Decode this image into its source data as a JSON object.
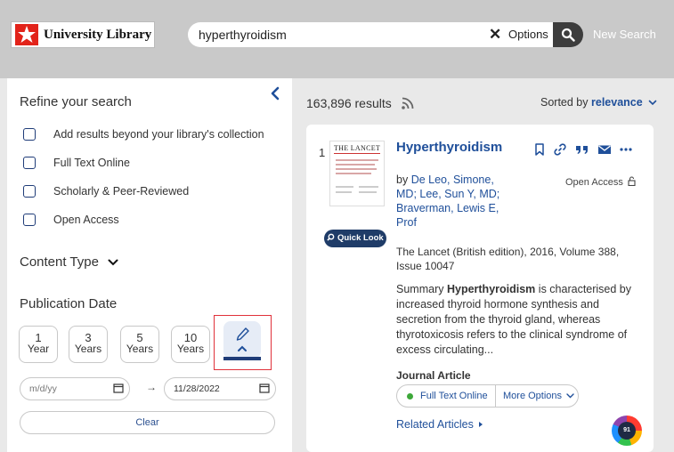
{
  "header": {
    "logo_text": "University Library",
    "search_value": "hyperthyroidism",
    "options_label": "Options",
    "new_search_label": "New Search"
  },
  "refine": {
    "title": "Refine your search",
    "checkboxes": [
      {
        "label": "Add results beyond your library's collection",
        "checked": false
      },
      {
        "label": "Full Text Online",
        "checked": false
      },
      {
        "label": "Scholarly & Peer-Reviewed",
        "checked": false
      },
      {
        "label": "Open Access",
        "checked": false
      }
    ],
    "content_type_label": "Content Type",
    "publication_date_label": "Publication Date",
    "year_buttons": [
      {
        "num": "1",
        "unit": "Year"
      },
      {
        "num": "3",
        "unit": "Years"
      },
      {
        "num": "5",
        "unit": "Years"
      },
      {
        "num": "10",
        "unit": "Years"
      }
    ],
    "date_from_placeholder": "m/d/yy",
    "date_to_value": "11/28/2022",
    "arrow": "→",
    "clear_label": "Clear"
  },
  "results": {
    "count": "163,896 results",
    "sorted_by_prefix": "Sorted by",
    "sorted_by_value": "relevance",
    "record": {
      "number": "1",
      "thumbnail_title": "THE LANCET",
      "quick_look_label": "Quick Look",
      "title": "Hyperthyroidism",
      "by_prefix": "by",
      "authors": "De Leo, Simone, MD; Lee, Sun Y, MD; Braverman, Lewis E, Prof",
      "open_access_label": "Open Access",
      "source": "The Lancet (British edition), 2016, Volume 388, Issue 10047",
      "summary_prefix": "Summary",
      "summary_term": "Hyperthyroidism",
      "summary_rest": "is characterised by increased thyroid hormone synthesis and secretion from the thyroid gland, whereas thyrotoxicosis refers to the clinical syndrome of excess circulating...",
      "doc_type": "Journal Article",
      "full_text_label": "Full Text Online",
      "more_options_label": "More Options",
      "related_label": "Related Articles",
      "altmetric_score": "91"
    }
  },
  "colors": {
    "accent_blue": "#1f4f9a",
    "logo_red": "#e2231a",
    "highlight_red": "#e0313a",
    "available_green": "#3da83a"
  },
  "icons": [
    "search-icon",
    "close-icon",
    "chevron-left-icon",
    "chevron-down-icon",
    "rss-icon",
    "bookmark-icon",
    "link-icon",
    "quote-icon",
    "email-icon",
    "more-icon",
    "pencil-icon",
    "calendar-icon",
    "lock-open-icon",
    "search-small-icon",
    "caret-right-icon"
  ]
}
